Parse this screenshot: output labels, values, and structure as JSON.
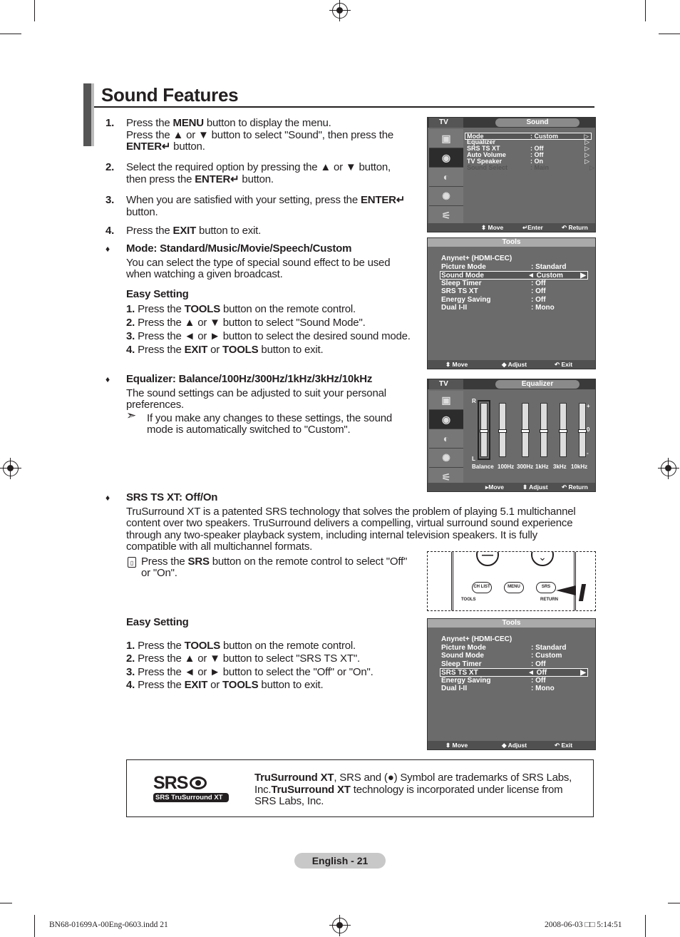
{
  "page_title": "Sound Features",
  "steps": [
    {
      "num": "1.",
      "lines": [
        "Press the ",
        "MENU",
        " button to display the menu."
      ],
      "line2": [
        "Press the ▲ or ▼ button to select \"Sound\", then press the"
      ],
      "line3": [
        "ENTER↵",
        " button."
      ]
    },
    {
      "num": "2.",
      "a": "Select the required option by pressing the ▲ or ▼ button,",
      "b1": "then press the ",
      "b2": "ENTER↵",
      "b3": " button."
    },
    {
      "num": "3.",
      "a1": "When you are satisfied with your setting, press the ",
      "a2": "ENTER↵",
      "b": "button."
    },
    {
      "num": "4.",
      "a1": "Press the ",
      "a2": "EXIT",
      "a3": " button to exit."
    }
  ],
  "bullet": "♦",
  "mode": {
    "heading": "Mode: Standard/Music/Movie/Speech/Custom",
    "body": [
      "You can select the type of special sound effect to be used",
      "when watching a given broadcast."
    ],
    "easy_title": "Easy Setting",
    "easy": [
      {
        "n": "1.",
        "t1": " Press the ",
        "b": "TOOLS",
        "t2": " button on the remote control."
      },
      {
        "n": "2.",
        "t1": " Press the ▲ or ▼ button to select \"Sound Mode\".",
        "b": "",
        "t2": ""
      },
      {
        "n": "3.",
        "t1": " Press the ◄ or ► button to select the desired sound mode.",
        "b": "",
        "t2": ""
      },
      {
        "n": "4.",
        "t1": " Press the ",
        "b": "EXIT",
        "t2": " or ",
        "b2": "TOOLS",
        "t3": " button to exit."
      }
    ]
  },
  "equalizer": {
    "heading": "Equalizer: Balance/100Hz/300Hz/1kHz/3kHz/10kHz",
    "body": [
      "The sound settings can be adjusted to suit your personal",
      "preferences."
    ],
    "note_icon": "arrow-note-icon",
    "note": [
      "If you make any changes to these settings, the sound",
      "mode is automatically switched to \"Custom\"."
    ]
  },
  "srs": {
    "heading": "SRS TS XT: Off/On",
    "body": [
      "TruSurround XT is a patented SRS technology that solves the problem of playing 5.1 multichannel",
      "content over two speakers. TruSurround delivers a compelling, virtual surround sound experience",
      "through any two-speaker playback system, including internal television speakers. It is fully",
      "compatible with all multichannel formats."
    ],
    "note_icon": "remote-note-icon",
    "note1": "Press the ",
    "note_b": "SRS",
    "note2": " button on the remote control to select \"Off\"",
    "note3": "or \"On\".",
    "easy_title": "Easy Setting",
    "easy": [
      {
        "n": "1.",
        "t1": " Press the ",
        "b": "TOOLS",
        "t2": " button on the remote control."
      },
      {
        "n": "2.",
        "t1": " Press the ▲ or ▼ button to select \"SRS TS XT\".",
        "b": "",
        "t2": ""
      },
      {
        "n": "3.",
        "t1": " Press the ◄ or ► button to select the \"Off\" or \"On\".",
        "b": "",
        "t2": ""
      },
      {
        "n": "4.",
        "t1": " Press the ",
        "b": "EXIT",
        "t2": " or ",
        "b2": "TOOLS",
        "t3": " button to exit."
      }
    ]
  },
  "sound_menu": {
    "tv": "TV",
    "title": "Sound",
    "items": [
      {
        "k": "Mode",
        "v": ": Custom"
      },
      {
        "k": "Equalizer",
        "v": ""
      },
      {
        "k": "SRS TS XT",
        "v": ": Off"
      },
      {
        "k": "Auto Volume",
        "v": ": Off"
      },
      {
        "k": "TV Speaker",
        "v": ": On"
      },
      {
        "k": "Sound Select",
        "v": ": Main"
      }
    ],
    "foot": [
      "⬍ Move",
      "↵Enter",
      "↶ Return"
    ]
  },
  "tools1": {
    "title": "Tools",
    "items": [
      {
        "k": "Anynet+ (HDMI-CEC)",
        "v": ""
      },
      {
        "k": "Picture Mode",
        "v": ": Standard"
      },
      {
        "k": "Sound Mode",
        "v": "◄ Custom"
      },
      {
        "k": "Sleep Timer",
        "v": ": Off"
      },
      {
        "k": "SRS TS XT",
        "v": ": Off"
      },
      {
        "k": "Energy Saving",
        "v": ": Off"
      },
      {
        "k": "Dual I-II",
        "v": ": Mono"
      }
    ],
    "foot": [
      "⬍ Move",
      "◆ Adjust",
      "↶ Exit"
    ]
  },
  "tools2": {
    "title": "Tools",
    "items": [
      {
        "k": "Anynet+ (HDMI-CEC)",
        "v": ""
      },
      {
        "k": "Picture Mode",
        "v": ": Standard"
      },
      {
        "k": "Sound Mode",
        "v": ": Custom"
      },
      {
        "k": "Sleep Timer",
        "v": ": Off"
      },
      {
        "k": "SRS TS XT",
        "v": "◄ Off"
      },
      {
        "k": "Energy Saving",
        "v": ": Off"
      },
      {
        "k": "Dual I-II",
        "v": ": Mono"
      }
    ],
    "foot": [
      "⬍ Move",
      "◆ Adjust",
      "↶ Exit"
    ]
  },
  "eq_menu": {
    "tv": "TV",
    "title": "Equalizer",
    "bands": [
      "Balance",
      "100Hz",
      "300Hz",
      "1kHz",
      "3kHz",
      "10kHz"
    ],
    "levels": [
      0,
      0,
      0,
      0,
      0,
      0
    ],
    "marks": {
      "r": "R",
      "l": "L",
      "plus": "+",
      "zero": "0",
      "minus": "-"
    },
    "foot": [
      "▸Move",
      "⬍ Adjust",
      "↶ Return"
    ]
  },
  "remote": {
    "ch_list": "CH LIST",
    "menu": "MENU",
    "srs": "SRS",
    "tools": "TOOLS",
    "return": "RETURN"
  },
  "trademark": {
    "logo": "SRS TruSurround XT",
    "l1b": "TruSurround XT",
    "l1": ", SRS and ",
    "l1c": " Symbol are trademarks of SRS Labs,",
    "l2": "Inc.",
    "l2b": "TruSurround XT",
    "l2c": " technology is incorporated under license from",
    "l3": "SRS Labs, Inc."
  },
  "page_label": "English - 21",
  "slug_left": "BN68-01699A-00Eng-0603.indd   21",
  "slug_right": "2008-06-03   □□ 5:14:51"
}
